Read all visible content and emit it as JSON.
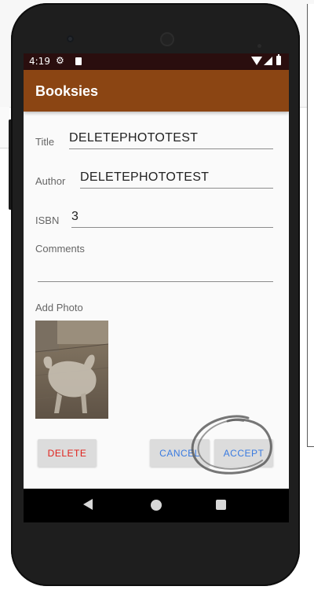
{
  "status_bar": {
    "time": "4:19",
    "icons": [
      "gear-icon",
      "sd-card-icon",
      "wifi-icon",
      "signal-icon",
      "battery-icon"
    ]
  },
  "app_bar": {
    "title": "Booksies",
    "color": "#8b4513"
  },
  "form": {
    "title": {
      "label": "Title",
      "value": "DELETEPHOTOTEST"
    },
    "author": {
      "label": "Author",
      "value": "DELETEPHOTOTEST"
    },
    "isbn": {
      "label": "ISBN",
      "value": "3"
    },
    "comments": {
      "label": "Comments",
      "value": ""
    },
    "photo": {
      "label": "Add Photo"
    }
  },
  "buttons": {
    "delete": "DELETE",
    "cancel": "CANCEL",
    "accept": "ACCEPT"
  },
  "colors": {
    "delete_text": "#e0201a",
    "action_text": "#3a7be0",
    "status_bar": "#2a0e0e"
  },
  "nav_bar": {
    "icons": [
      "back-icon",
      "home-icon",
      "recents-icon"
    ]
  }
}
